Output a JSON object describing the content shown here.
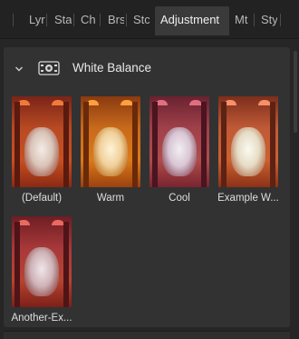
{
  "tabs": [
    {
      "label": "Lyr"
    },
    {
      "label": "Sta"
    },
    {
      "label": "Ch"
    },
    {
      "label": "Brs"
    },
    {
      "label": "Stc"
    },
    {
      "label": "Adjustment"
    },
    {
      "label": "Mt"
    },
    {
      "label": "Sty"
    }
  ],
  "section": {
    "title": "White Balance"
  },
  "presets": [
    {
      "label": "(Default)"
    },
    {
      "label": "Warm"
    },
    {
      "label": "Cool"
    },
    {
      "label": "Example W..."
    },
    {
      "label": "Another-Ex..."
    }
  ],
  "colors": {
    "accent_active_tab": "#3a3a3a",
    "panel": "#323232"
  }
}
